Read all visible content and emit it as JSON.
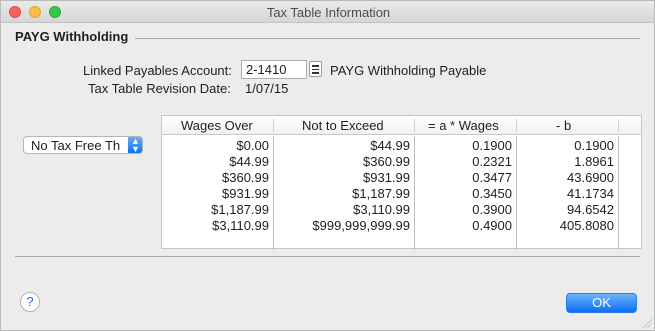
{
  "window": {
    "title": "Tax Table Information"
  },
  "section": {
    "title": "PAYG Withholding"
  },
  "linked_account": {
    "label": "Linked Payables Account:",
    "value": "2-1410",
    "name": "PAYG Withholding Payable"
  },
  "revision": {
    "label": "Tax Table Revision Date:",
    "value": "1/07/15"
  },
  "scale_popup": {
    "selected": "No Tax Free Th"
  },
  "table": {
    "headers": [
      "Wages Over",
      "Not to Exceed",
      "= a * Wages",
      "- b"
    ],
    "rows": [
      [
        "$0.00",
        "$44.99",
        "0.1900",
        "0.1900"
      ],
      [
        "$44.99",
        "$360.99",
        "0.2321",
        "1.8961"
      ],
      [
        "$360.99",
        "$931.99",
        "0.3477",
        "43.6900"
      ],
      [
        "$931.99",
        "$1,187.99",
        "0.3450",
        "41.1734"
      ],
      [
        "$1,187.99",
        "$3,110.99",
        "0.3900",
        "94.6542"
      ],
      [
        "$3,110.99",
        "$999,999,999.99",
        "0.4900",
        "405.8080"
      ]
    ]
  },
  "buttons": {
    "help": "?",
    "ok": "OK"
  },
  "icons": {
    "close": "close-icon",
    "minimize": "minimize-icon",
    "maximize": "maximize-icon",
    "list": "list-icon",
    "popup_arrows": "up-down-arrows-icon",
    "help": "question-icon",
    "resize": "resize-grip-icon"
  },
  "colors": {
    "accent": "#0d6ff6",
    "close": "#fc605c",
    "minimize": "#fdbc40",
    "maximize": "#34c84a"
  }
}
